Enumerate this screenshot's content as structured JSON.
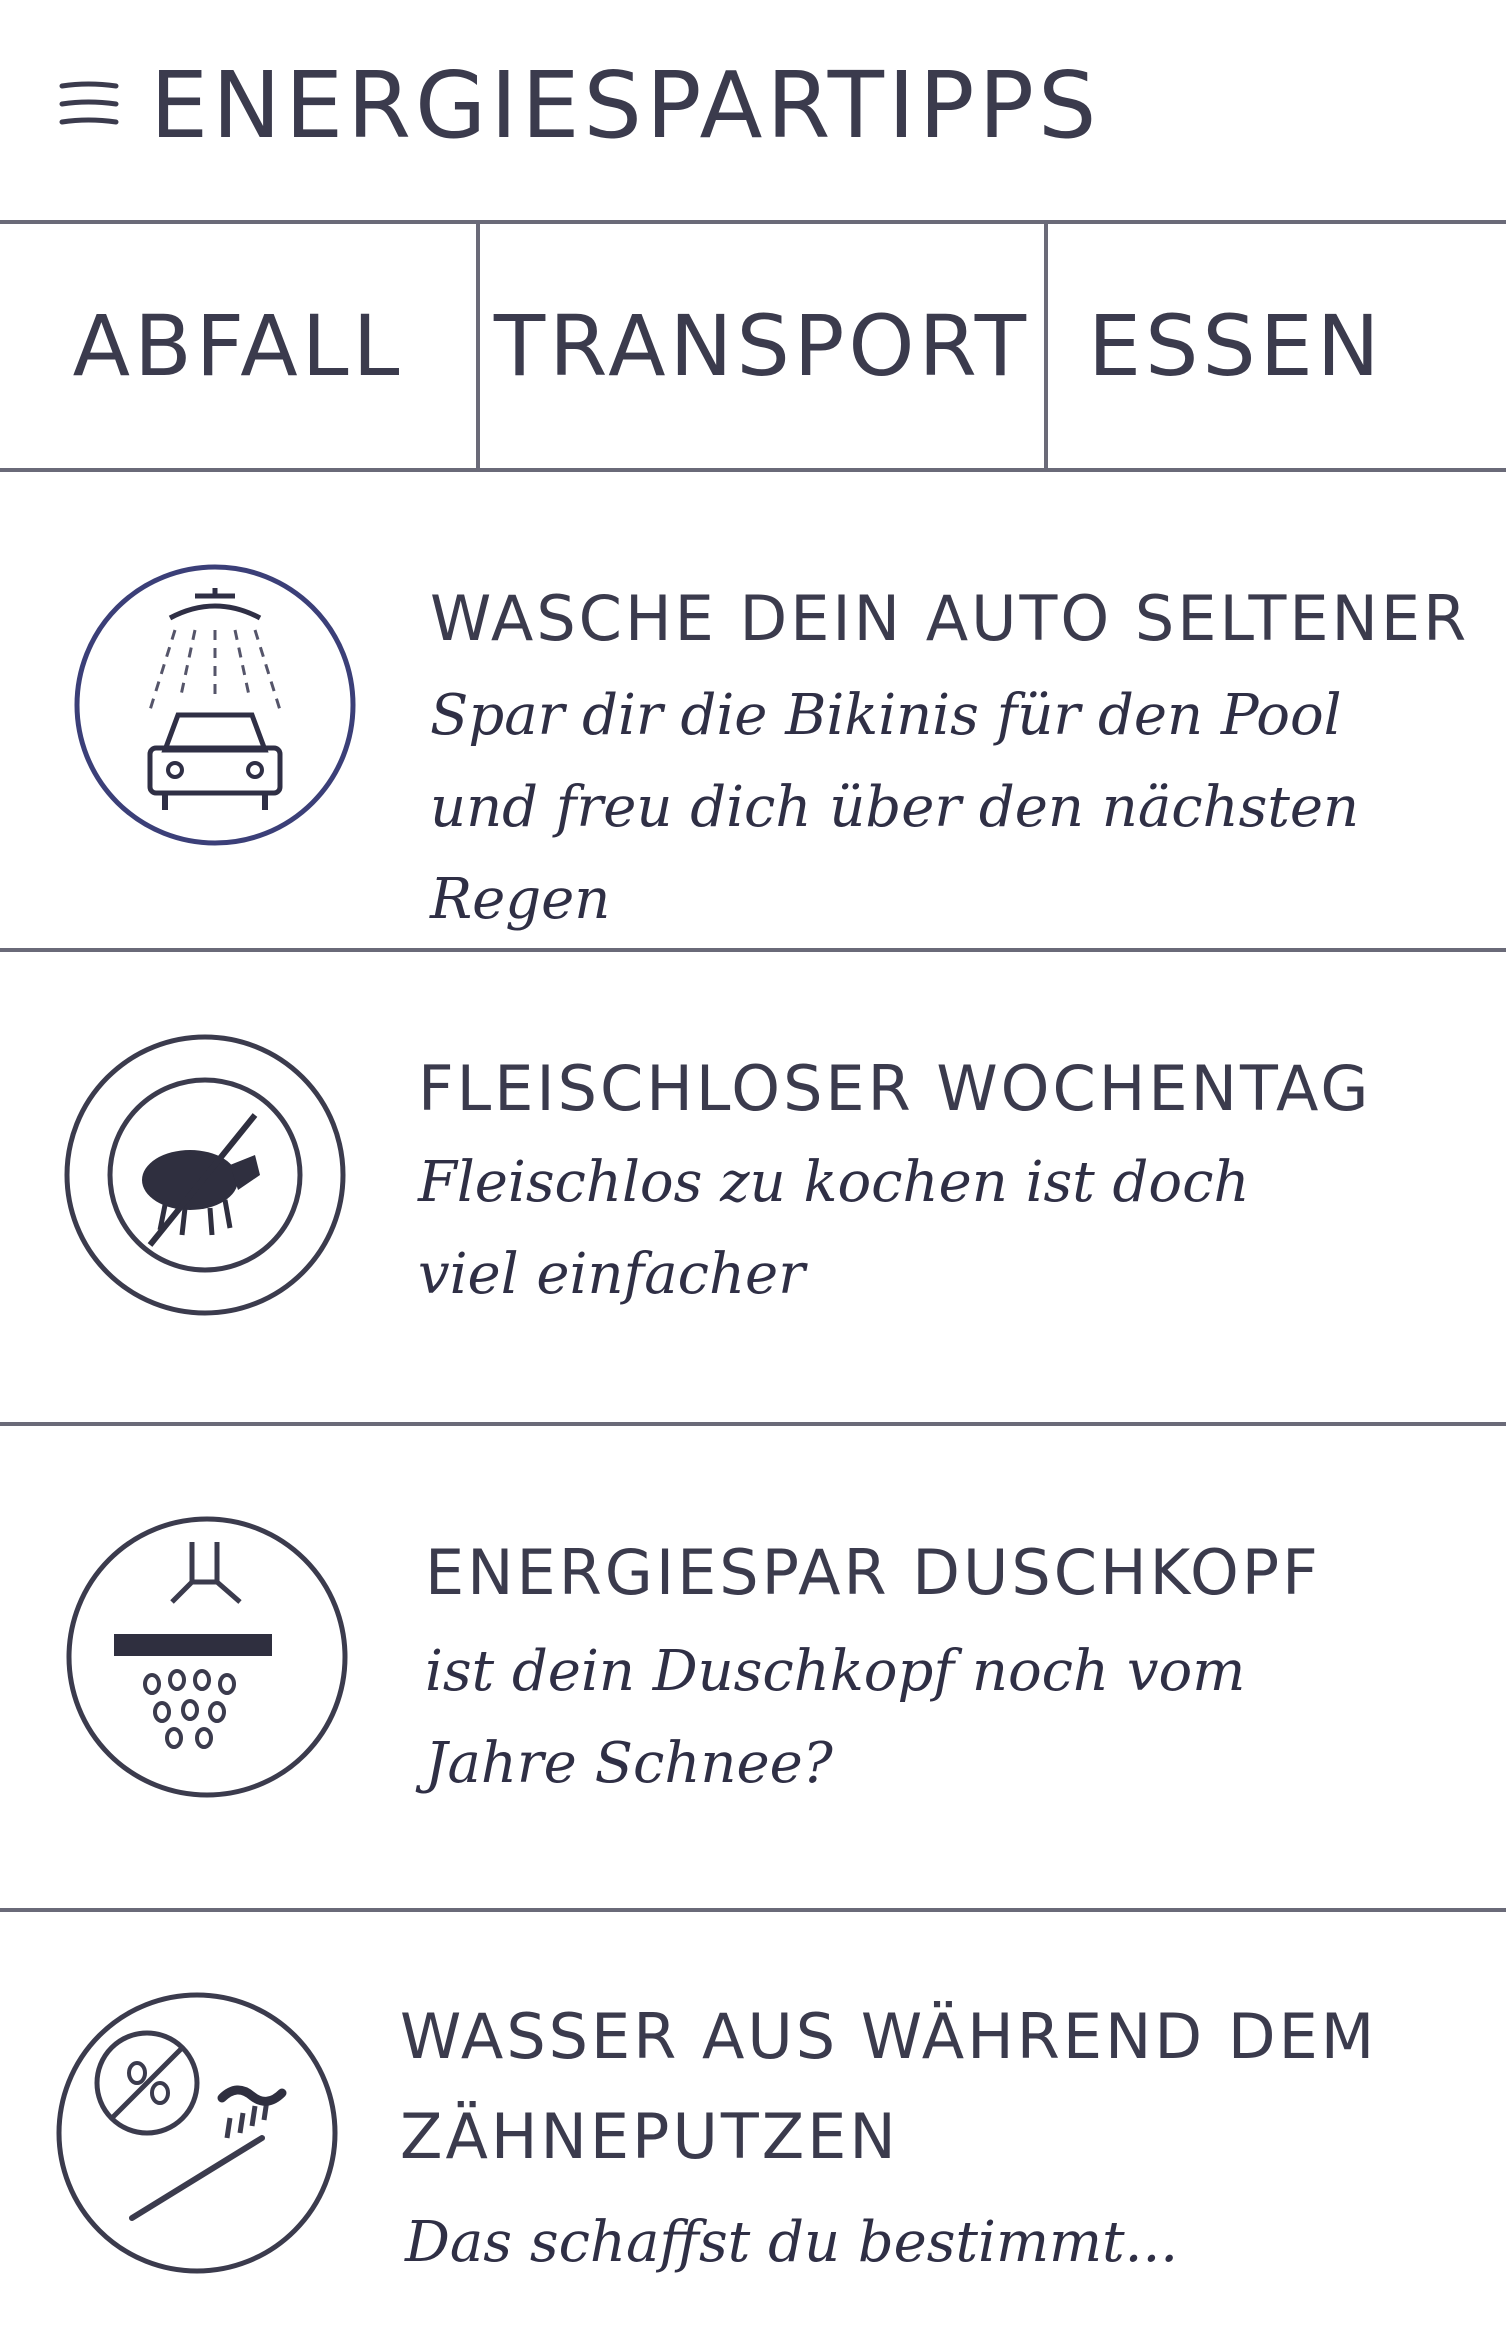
{
  "header": {
    "menu_icon": "hamburger-menu-icon",
    "title": "ENERGIESPARTIPPS"
  },
  "tabs": [
    {
      "label": "ABFALL"
    },
    {
      "label": "TRANSPORT"
    },
    {
      "label": "ESSEN"
    }
  ],
  "tips": [
    {
      "icon": "car-wash-icon",
      "title": "WASCHE DEIN AUTO SELTENER",
      "text": "Spar dir die Bikinis für den Pool und freu dich über den nächsten Regen"
    },
    {
      "icon": "no-meat-icon",
      "title": "FLEISCHLOSER WOCHENTAG",
      "text": "Fleischlos zu kochen ist doch viel einfacher"
    },
    {
      "icon": "shower-head-icon",
      "title": "ENERGIESPAR DUSCHKOPF",
      "text": "ist dein Duschkopf noch vom Jahre Schnee?"
    },
    {
      "icon": "no-water-toothbrush-icon",
      "title": "WASSER AUS WÄHREND DEM ZÄHNEPUTZEN",
      "text": "Das schaffst du bestimmt..."
    }
  ]
}
